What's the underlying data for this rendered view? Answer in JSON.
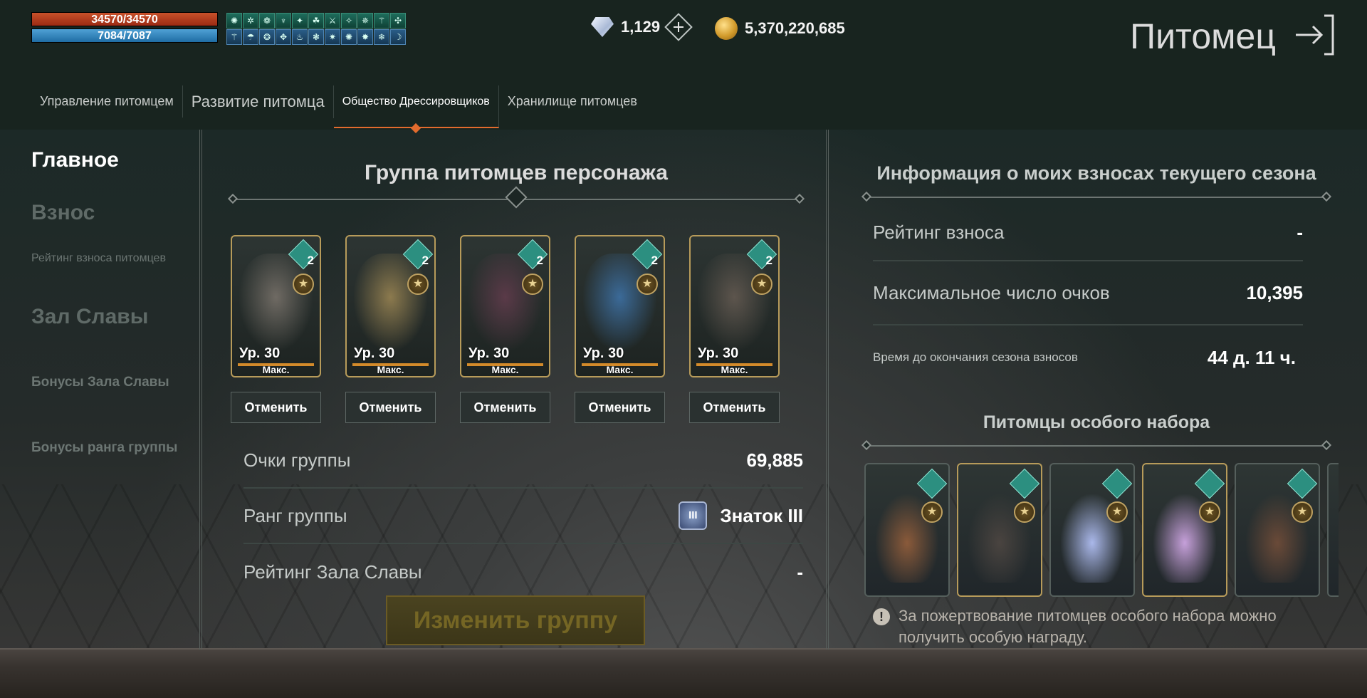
{
  "hud": {
    "hp": "34570/34570",
    "mp": "7084/7087"
  },
  "buffs": [
    "✺",
    "✲",
    "❁",
    "♆",
    "✦",
    "☘",
    "⚔",
    "✧",
    "✵",
    "⚚",
    "✣",
    "⚚",
    "☂",
    "❂",
    "✥",
    "♨",
    "❃",
    "✷",
    "✺",
    "✸",
    "❄",
    "☽"
  ],
  "currency": {
    "gems": "1,129",
    "gold": "5,370,220,685"
  },
  "header": {
    "title": "Питомец"
  },
  "tabs": [
    "Управление питомцем",
    "Развитие питомца",
    "Общество Дрессировщиков",
    "Хранилище питомцев"
  ],
  "sidebar": {
    "main": "Главное",
    "contribution": "Взнос",
    "contribution_rating": "Рейтинг взноса питомцев",
    "hall": "Зал Славы",
    "hall_bonuses": "Бонусы Зала Славы",
    "rank_bonuses": "Бонусы ранга группы"
  },
  "group": {
    "title": "Группа питомцев персонажа",
    "pets": [
      {
        "badge": "2",
        "level": "Ур. 30",
        "max": "Макс.",
        "cancel": "Отменить",
        "color": "#6f6a63"
      },
      {
        "badge": "2",
        "level": "Ур. 30",
        "max": "Макс.",
        "cancel": "Отменить",
        "color": "#8c7a4e"
      },
      {
        "badge": "2",
        "level": "Ур. 30",
        "max": "Макс.",
        "cancel": "Отменить",
        "color": "#5a3a48"
      },
      {
        "badge": "2",
        "level": "Ур. 30",
        "max": "Макс.",
        "cancel": "Отменить",
        "color": "#3b6a98"
      },
      {
        "badge": "2",
        "level": "Ур. 30",
        "max": "Макс.",
        "cancel": "Отменить",
        "color": "#5d554d"
      }
    ],
    "points_label": "Очки группы",
    "points_value": "69,885",
    "rank_label": "Ранг группы",
    "rank_icon": "III",
    "rank_value": "Знаток III",
    "hall_rating_label": "Рейтинг Зала Славы",
    "hall_rating_value": "-",
    "change_button": "Изменить группу"
  },
  "season": {
    "title": "Информация о моих взносах текущего сезона",
    "rating_label": "Рейтинг взноса",
    "rating_value": "-",
    "max_points_label": "Максимальное число очков",
    "max_points_value": "10,395",
    "time_label": "Время до окончания сезона взносов",
    "time_value": "44 д. 11 ч."
  },
  "special": {
    "title": "Питомцы особого набора",
    "pets": [
      {
        "color": "#8a5a3a",
        "gold": false
      },
      {
        "color": "#4a4440",
        "gold": true
      },
      {
        "color": "#aab8ea",
        "gold": false
      },
      {
        "color": "#c6a0da",
        "gold": true
      },
      {
        "color": "#6a4a38",
        "gold": false
      }
    ],
    "note": "За пожертвование питомцев особого набора можно получить особую награду."
  }
}
